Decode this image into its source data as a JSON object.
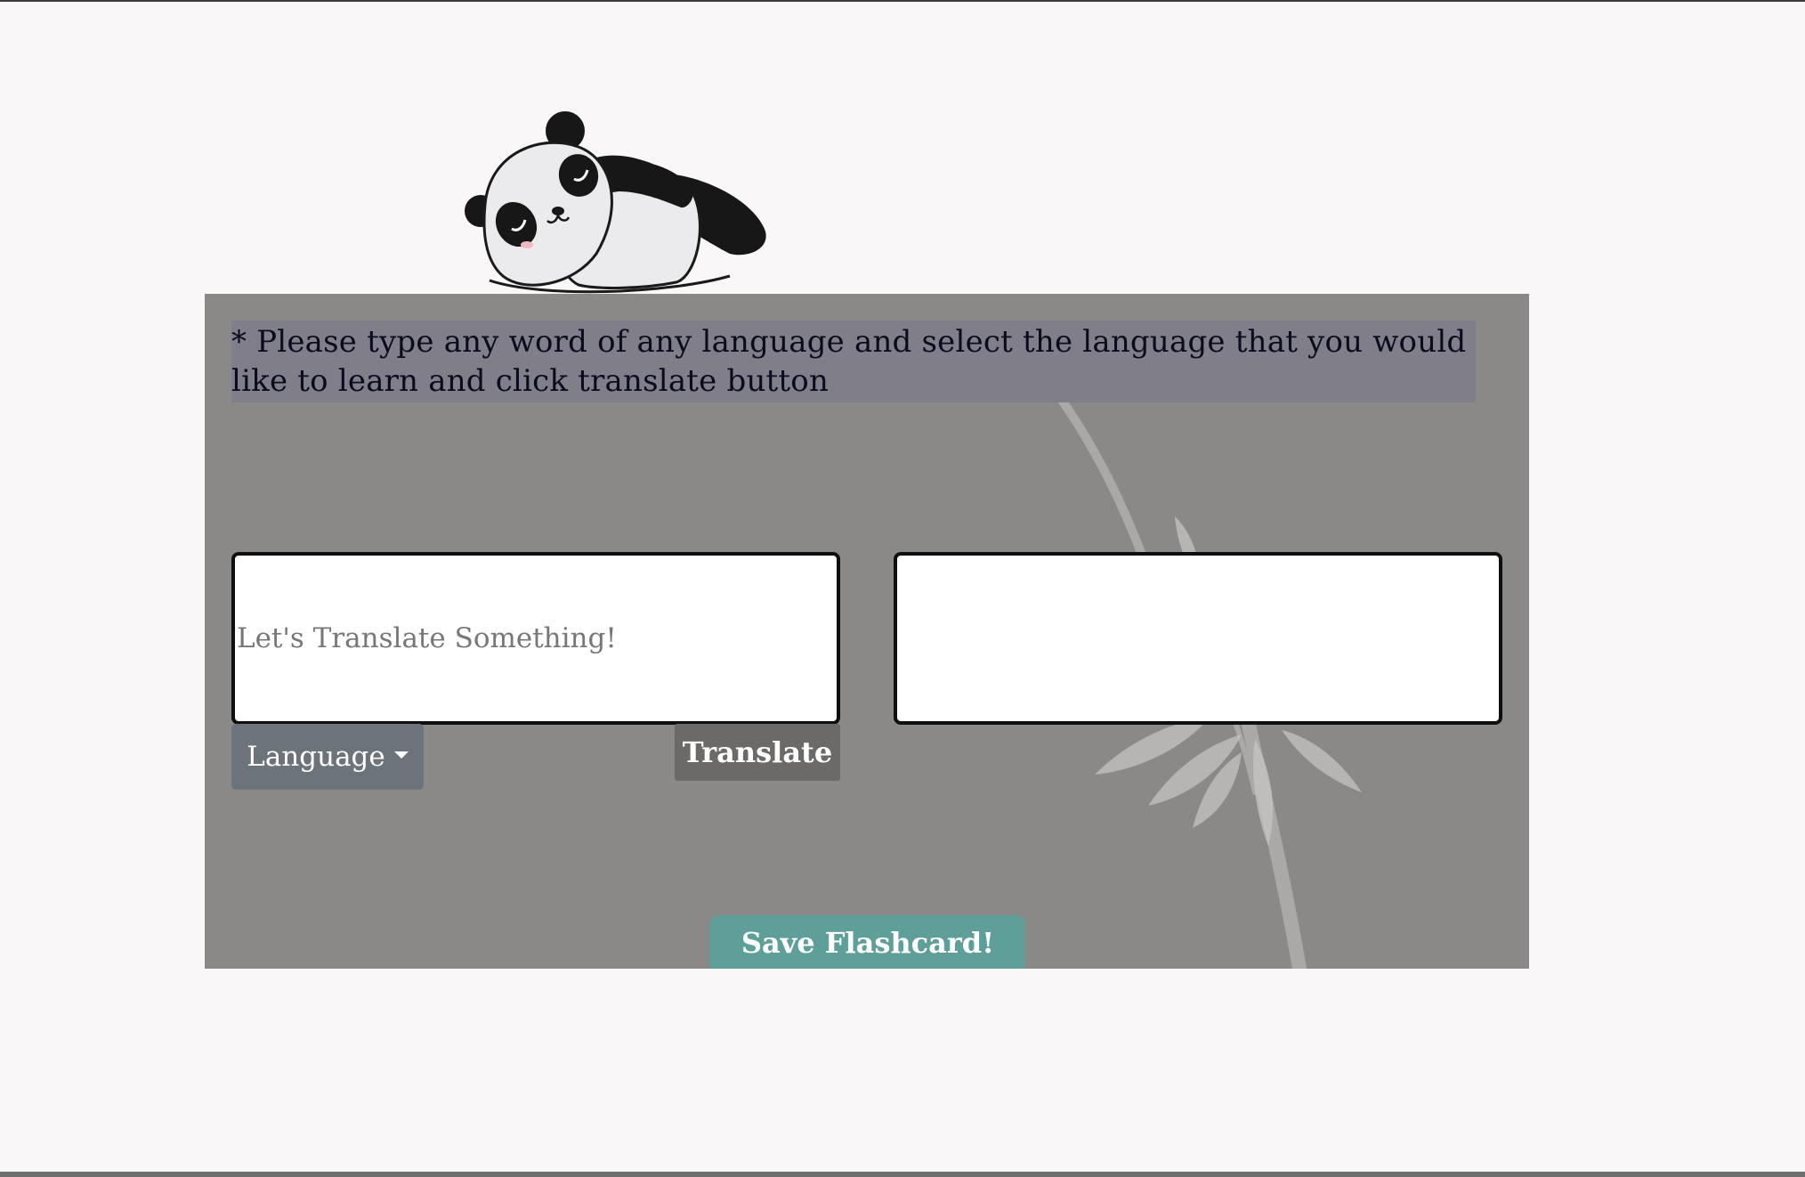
{
  "instructions": {
    "text": "* Please type any word of any language and select the language that you would like to learn and click translate button"
  },
  "source": {
    "placeholder": "Let's Translate Something!",
    "value": ""
  },
  "target": {
    "value": ""
  },
  "language_dropdown": {
    "label": "Language"
  },
  "translate_button": {
    "label": "Translate"
  },
  "save_button": {
    "label": "Save Flashcard!"
  },
  "colors": {
    "page_background": "#f9f7f7",
    "panel_background": "#8a8987",
    "language_button": "#6c737b",
    "translate_button": "#6b6a68",
    "save_button": "#5f9f99"
  },
  "icons": {
    "mascot": "sleeping-panda-illustration",
    "background": "bamboo-illustration",
    "dropdown": "caret-down-icon"
  }
}
